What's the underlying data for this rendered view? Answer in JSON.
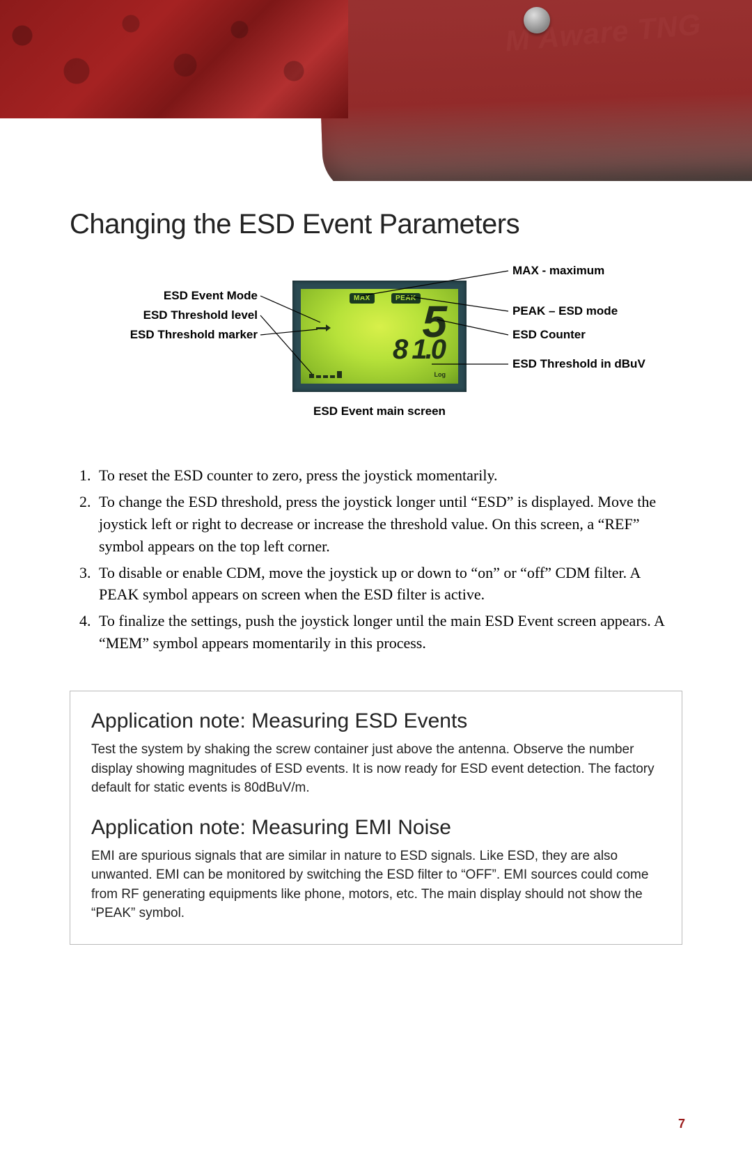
{
  "header": {
    "device_text": "M Aware TNG"
  },
  "title": "Changing the ESD Event Parameters",
  "diagram": {
    "left_labels": {
      "mode": "ESD Event Mode",
      "threshold_level": "ESD Threshold level",
      "threshold_marker": "ESD Threshold marker"
    },
    "right_labels": {
      "max": "MAX - maximum",
      "peak": "PEAK – ESD mode",
      "counter": "ESD Counter",
      "threshold_dbuv": "ESD Threshold in dBuV"
    },
    "lcd": {
      "badge_max": "MAX",
      "badge_peak": "PEAK",
      "big_value": "5",
      "mid_value": "8 1.0",
      "log": "Log"
    },
    "caption": "ESD Event main screen"
  },
  "steps": [
    "To reset the ESD counter to zero, press the joystick momentarily.",
    "To change the ESD threshold, press the joystick longer until “ESD” is displayed. Move the joystick left or right to decrease or increase the threshold value. On this screen, a “REF” symbol appears on the top left corner.",
    "To disable or enable CDM, move the joystick up or down to “on” or “off” CDM filter. A PEAK symbol appears on screen when the ESD filter is active.",
    "To finalize the settings, push the joystick longer until the main ESD Event screen appears. A “MEM” symbol appears momentarily in this process."
  ],
  "notes": {
    "esd": {
      "heading": "Application note: Measuring ESD Events",
      "body": "Test the system by shaking the screw container just above the antenna. Observe the number display showing magnitudes of ESD events. It is now ready for ESD event detection. The factory default for static events is 80dBuV/m."
    },
    "emi": {
      "heading": "Application note: Measuring EMI Noise",
      "body": "EMI are spurious signals that are similar in nature to ESD signals. Like ESD, they are also unwanted. EMI can be monitored by switching the ESD filter to “OFF”. EMI sources could come from RF generating equipments like phone, motors, etc. The main display should not show the “PEAK” symbol."
    }
  },
  "page_number": "7"
}
